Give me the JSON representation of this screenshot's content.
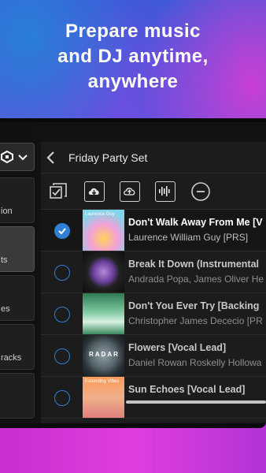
{
  "promo": {
    "line1": "Prepare music",
    "line2": "and DJ anytime,",
    "line3": "anywhere"
  },
  "sidebar": {
    "items": [
      {
        "label": "ion",
        "active": false
      },
      {
        "label": "ts",
        "active": true
      },
      {
        "label": "es",
        "active": false
      },
      {
        "label": "racks",
        "active": false
      }
    ]
  },
  "header": {
    "title": "Friday Party Set",
    "back_icon": "chevron-left-icon"
  },
  "toolbar": {
    "icons": [
      "select-all-icon",
      "cloud-download-icon",
      "cloud-upload-icon",
      "waveform-icon",
      "remove-icon"
    ]
  },
  "tracks": [
    {
      "title": "Don't Walk Away From Me [V",
      "artist": "Laurence William Guy [PRS]",
      "selected": true,
      "art_label": "Laurence Guy"
    },
    {
      "title": "Break It Down (Instrumental",
      "artist": "Andrada Popa, James Oliver He",
      "selected": false,
      "art_label": ""
    },
    {
      "title": "Don't You Ever Try [Backing",
      "artist": "Christopher James Dececio [PR",
      "selected": false,
      "art_label": ""
    },
    {
      "title": "Flowers [Vocal Lead]",
      "artist": "Daniel Rowan Roskelly Hollowa",
      "selected": false,
      "art_label": "RADAR"
    },
    {
      "title": "Sun Echoes [Vocal Lead]",
      "artist": "",
      "selected": false,
      "art_label": "Extending Vibes"
    }
  ],
  "colors": {
    "accent": "#2f7fd4",
    "panel": "#1c1c1c"
  }
}
